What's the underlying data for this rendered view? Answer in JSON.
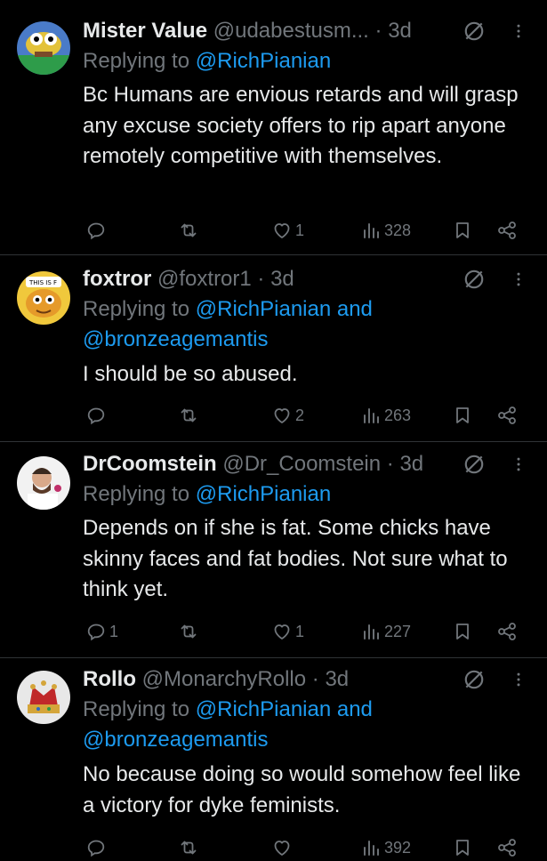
{
  "tweets": [
    {
      "name": "Mister Value",
      "handle": "@udabestusm...",
      "time": "3d",
      "replying_prefix": "Replying to",
      "replying_to": "@RichPianian",
      "body": "Bc Humans are envious retards and will grasp any excuse society offers to rip apart anyone remotely competitive with themselves.",
      "reply_count": "",
      "retweet_count": "",
      "like_count": "1",
      "view_count": "328"
    },
    {
      "name": "foxtror",
      "handle": "@foxtror1",
      "time": "3d",
      "replying_prefix": "Replying to",
      "replying_to": "@RichPianian and",
      "replying_to_2": "@bronzeagemantis",
      "body": "I should be so abused.",
      "reply_count": "",
      "retweet_count": "",
      "like_count": "2",
      "view_count": "263",
      "avatar_caption": "THIS IS F"
    },
    {
      "name": "DrCoomstein",
      "handle": "@Dr_Coomstein",
      "time": "3d",
      "replying_prefix": "Replying to",
      "replying_to": "@RichPianian",
      "body": "Depends on if she is fat. Some chicks have skinny faces and fat bodies. Not sure what to think yet.",
      "reply_count": "1",
      "retweet_count": "",
      "like_count": "1",
      "view_count": "227"
    },
    {
      "name": "Rollo",
      "handle": "@MonarchyRollo",
      "time": "3d",
      "replying_prefix": "Replying to",
      "replying_to": "@RichPianian and",
      "replying_to_2": "@bronzeagemantis",
      "body": "No because doing so would somehow feel like a victory for dyke feminists.",
      "reply_count": "",
      "retweet_count": "",
      "like_count": "",
      "view_count": "392"
    }
  ],
  "colors": {
    "background": "#000000",
    "text": "#e7e9ea",
    "muted": "#71767b",
    "link": "#1d9bf0",
    "separator": "#2f3336"
  },
  "icons": [
    "reply-icon",
    "retweet-icon",
    "like-icon",
    "views-icon",
    "bookmark-icon",
    "share-icon",
    "grok-icon",
    "more-icon"
  ]
}
